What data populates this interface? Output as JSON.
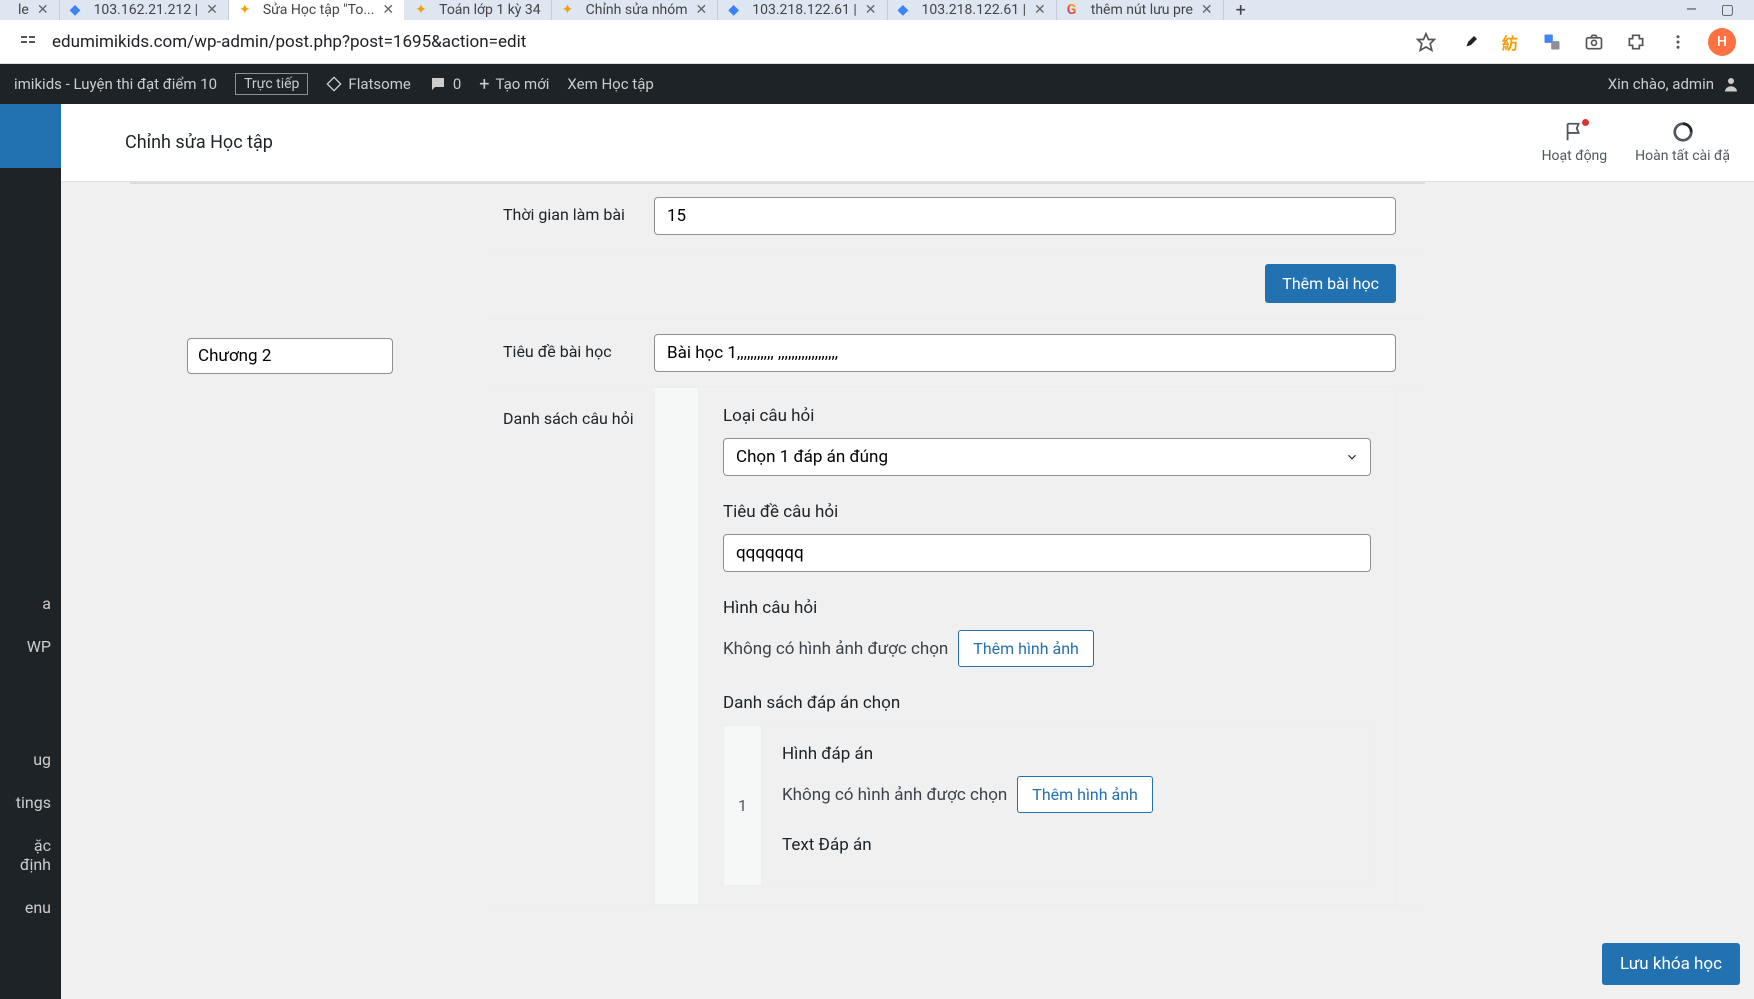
{
  "tabs": [
    {
      "title": "le",
      "favicon": "",
      "active": false
    },
    {
      "title": "103.162.21.212 |",
      "favicon": "blue",
      "active": false
    },
    {
      "title": "Sửa Học tập \"To...",
      "favicon": "orange",
      "active": true
    },
    {
      "title": "Toán lớp 1 kỳ 34",
      "favicon": "orange",
      "active": false
    },
    {
      "title": "Chỉnh sửa nhóm",
      "favicon": "orange",
      "active": false
    },
    {
      "title": "103.218.122.61 |",
      "favicon": "blue",
      "active": false
    },
    {
      "title": "103.218.122.61 |",
      "favicon": "blue",
      "active": false
    },
    {
      "title": "thêm nút lưu pre",
      "favicon": "google",
      "active": false
    }
  ],
  "url": "edumimikids.com/wp-admin/post.php?post=1695&action=edit",
  "avatar_letter": "H",
  "wpbar": {
    "site": "imikids - Luyện thi đạt điểm 10",
    "live": "Trực tiếp",
    "flatsome": "Flatsome",
    "comments": "0",
    "new": "Tạo mới",
    "view": "Xem Học tập",
    "greeting": "Xin chào, admin"
  },
  "sidebar_items": [
    "a",
    "WP",
    "ug",
    "tings",
    "ặc định",
    "enu"
  ],
  "page": {
    "title": "Chỉnh sửa Học tập",
    "activity": "Hoạt động",
    "finish": "Hoàn tất cài đặ"
  },
  "fields": {
    "time_label": "Thời gian làm bài",
    "time_value": "15",
    "chapter_value": "Chương 2",
    "lesson_title_label": "Tiêu đề bài học",
    "lesson_title_value": "Bài học 1,,,,,,,,,,, ,,,,,,,,,,,,,,,,,,",
    "question_list_label": "Danh sách câu hỏi",
    "add_lesson_btn": "Thêm bài học"
  },
  "question": {
    "type_label": "Loại câu hỏi",
    "type_value": "Chọn 1 đáp án đúng",
    "title_label": "Tiêu đề câu hỏi",
    "title_value": "qqqqqqq",
    "image_label": "Hình câu hỏi",
    "no_image": "Không có hình ảnh được chọn",
    "add_image": "Thêm hình ảnh",
    "answers_label": "Danh sách đáp án chọn"
  },
  "answer": {
    "num": "1",
    "image_label": "Hình đáp án",
    "no_image": "Không có hình ảnh được chọn",
    "add_image": "Thêm hình ảnh",
    "text_label": "Text Đáp án"
  },
  "save_course": "Lưu khóa học"
}
